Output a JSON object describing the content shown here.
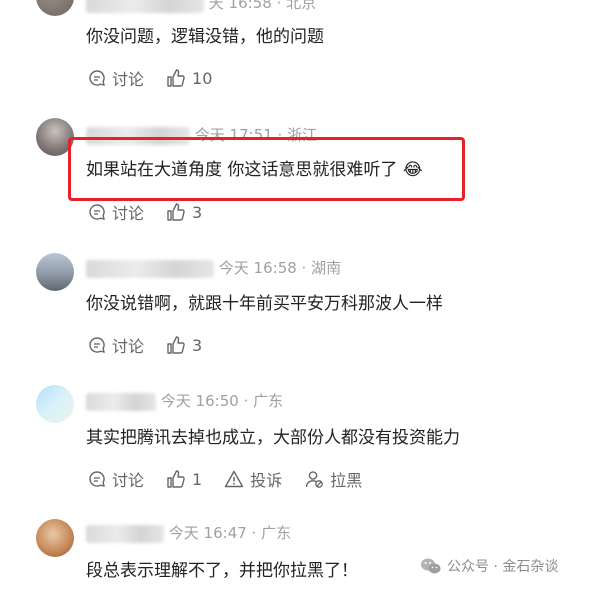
{
  "comments": [
    {
      "meta": "天 16:58 · 北京",
      "text": "你没问题，逻辑没错，他的问题",
      "discuss": "讨论",
      "likes": "10"
    },
    {
      "meta": "今天 17:51 · 浙江",
      "text": "如果站在大道角度 你这话意思就很难听了",
      "emoji": "😂",
      "discuss": "讨论",
      "likes": "3"
    },
    {
      "meta": "今天 16:58 · 湖南",
      "text": "你没说错啊，就跟十年前买平安万科那波人一样",
      "discuss": "讨论",
      "likes": "3"
    },
    {
      "meta": "今天 16:50 · 广东",
      "text": "其实把腾讯去掉也成立，大部份人都没有投资能力",
      "discuss": "讨论",
      "likes": "1",
      "report": "投诉",
      "block": "拉黑"
    },
    {
      "meta": "今天 16:47 · 广东",
      "text": "段总表示理解不了，并把你拉黑了！"
    }
  ],
  "watermark": "公众号 · 金石杂谈",
  "colors": {
    "highlight": "#e8202a",
    "meta": "#a0a0a0",
    "text": "#222222"
  }
}
